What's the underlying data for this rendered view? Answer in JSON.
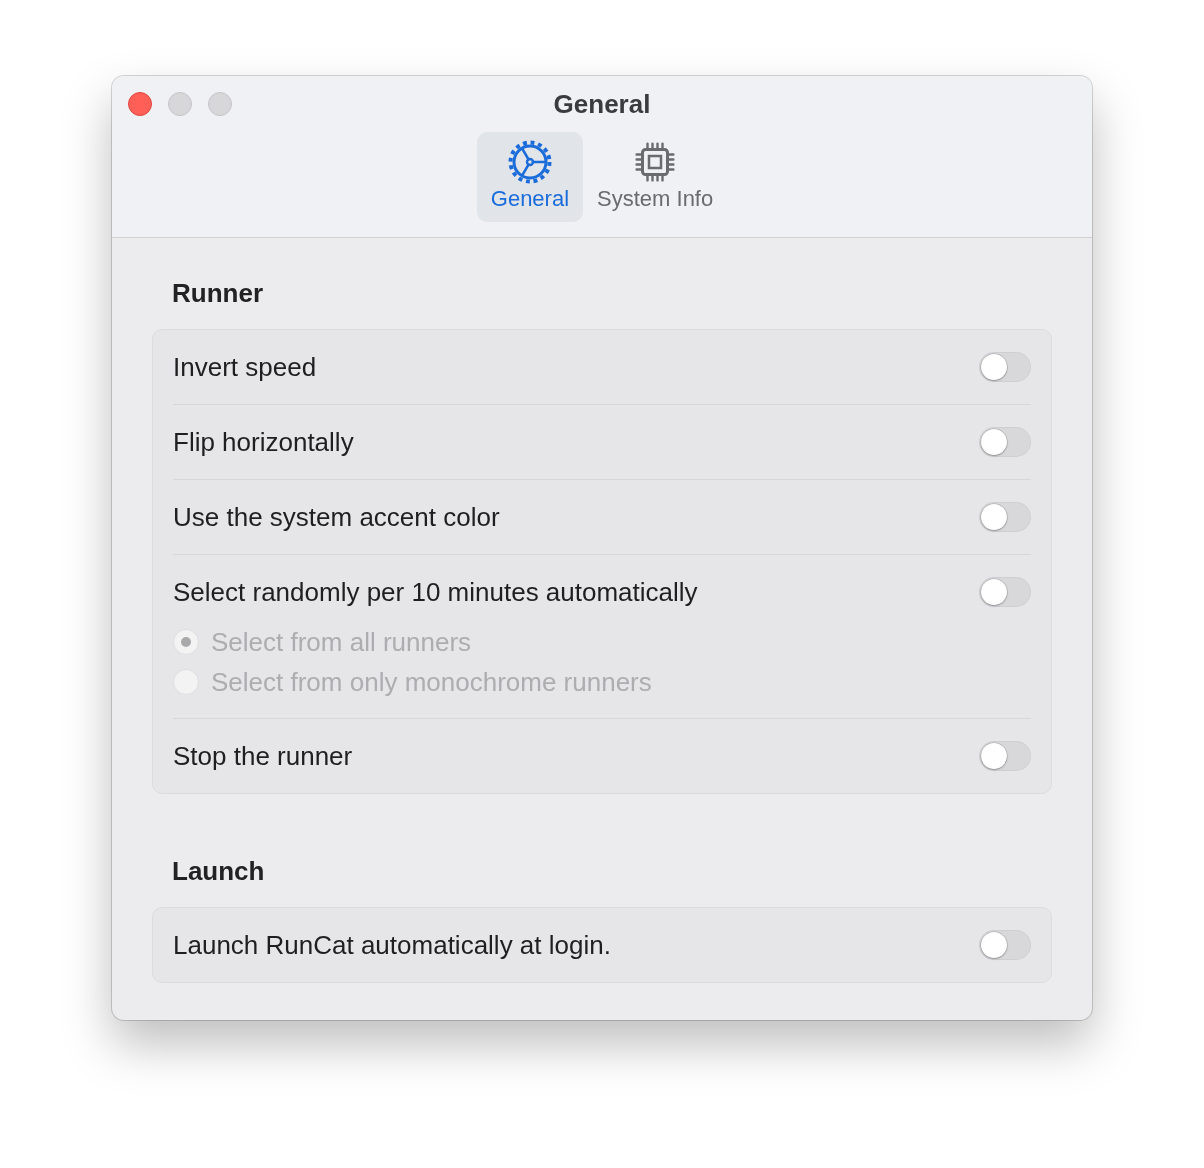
{
  "window": {
    "title": "General",
    "buttons": [
      {
        "kind": "close",
        "disabled": false
      },
      {
        "kind": "minimize",
        "disabled": true
      },
      {
        "kind": "zoom",
        "disabled": true
      }
    ]
  },
  "tabs": [
    {
      "label": "General",
      "selected": true
    },
    {
      "label": "System Info",
      "selected": false
    }
  ],
  "sections": [
    {
      "heading": "Runner",
      "rows": [
        {
          "label": "Invert speed",
          "on": false
        },
        {
          "label": "Flip horizontally",
          "on": false
        },
        {
          "label": "Use the system accent color",
          "on": false
        },
        {
          "label": "Select randomly per 10 minutes automatically",
          "on": false,
          "options": [
            {
              "label": "Select from all runners",
              "selected": true,
              "disabled": true
            },
            {
              "label": "Select from only monochrome runners",
              "selected": false,
              "disabled": true
            }
          ]
        },
        {
          "label": "Stop the runner",
          "on": false
        }
      ]
    },
    {
      "heading": "Launch",
      "rows": [
        {
          "label": "Launch RunCat automatically at login.",
          "on": false
        }
      ]
    }
  ]
}
